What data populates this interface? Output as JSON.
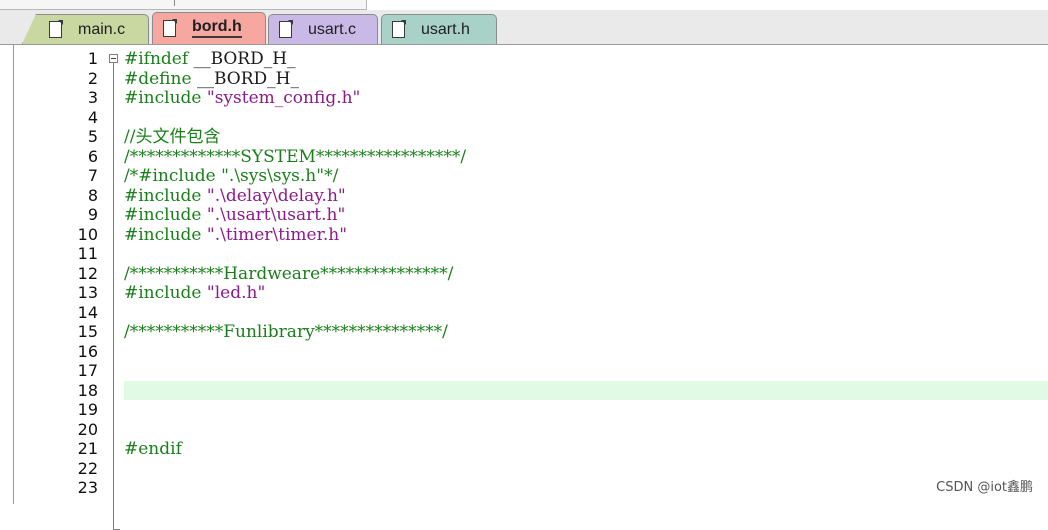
{
  "tabs": [
    {
      "label": "main.c",
      "active": false,
      "color": "#c8d8a0"
    },
    {
      "label": "bord.h",
      "active": true,
      "color": "#f6a7a0"
    },
    {
      "label": "usart.c",
      "active": false,
      "color": "#c8b9e6"
    },
    {
      "label": "usart.h",
      "active": false,
      "color": "#a8d1c8"
    }
  ],
  "editor": {
    "current_line": 18,
    "current_line_color": "#e0fae6",
    "lines": [
      {
        "n": "1",
        "segs": [
          {
            "t": "#ifndef ",
            "c": "pre"
          },
          {
            "t": "__BORD_H_",
            "c": "plain"
          }
        ]
      },
      {
        "n": "2",
        "segs": [
          {
            "t": "#define ",
            "c": "pre"
          },
          {
            "t": "__BORD_H_",
            "c": "plain"
          }
        ]
      },
      {
        "n": "3",
        "segs": [
          {
            "t": "#include ",
            "c": "pre"
          },
          {
            "t": "\"system_config.h\"",
            "c": "str"
          }
        ]
      },
      {
        "n": "4",
        "segs": []
      },
      {
        "n": "5",
        "segs": [
          {
            "t": "//头文件包含",
            "c": "com"
          }
        ]
      },
      {
        "n": "6",
        "segs": [
          {
            "t": "/*************SYSTEM*****************/",
            "c": "com"
          }
        ]
      },
      {
        "n": "7",
        "segs": [
          {
            "t": "/*#include \".\\sys\\sys.h\"*/",
            "c": "com"
          }
        ]
      },
      {
        "n": "8",
        "segs": [
          {
            "t": "#include ",
            "c": "pre"
          },
          {
            "t": "\".\\delay\\delay.h\"",
            "c": "str"
          }
        ]
      },
      {
        "n": "9",
        "segs": [
          {
            "t": "#include ",
            "c": "pre"
          },
          {
            "t": "\".\\usart\\usart.h\"",
            "c": "str"
          }
        ]
      },
      {
        "n": "10",
        "segs": [
          {
            "t": "#include ",
            "c": "pre"
          },
          {
            "t": "\".\\timer\\timer.h\"",
            "c": "str"
          }
        ]
      },
      {
        "n": "11",
        "segs": []
      },
      {
        "n": "12",
        "segs": [
          {
            "t": "/***********Hardweare***************/",
            "c": "com"
          }
        ]
      },
      {
        "n": "13",
        "segs": [
          {
            "t": "#include ",
            "c": "pre"
          },
          {
            "t": "\"led.h\"",
            "c": "str"
          }
        ]
      },
      {
        "n": "14",
        "segs": []
      },
      {
        "n": "15",
        "segs": [
          {
            "t": "/***********Funlibrary***************/",
            "c": "com"
          }
        ]
      },
      {
        "n": "16",
        "segs": []
      },
      {
        "n": "17",
        "segs": []
      },
      {
        "n": "18",
        "segs": []
      },
      {
        "n": "19",
        "segs": []
      },
      {
        "n": "20",
        "segs": []
      },
      {
        "n": "21",
        "segs": [
          {
            "t": "#endif",
            "c": "pre"
          }
        ]
      },
      {
        "n": "22",
        "segs": []
      },
      {
        "n": "23",
        "segs": []
      }
    ]
  },
  "icons": {
    "tab_file": "file-icon",
    "fold": "fold-minus-icon"
  },
  "watermark": "CSDN @iot鑫鹏"
}
